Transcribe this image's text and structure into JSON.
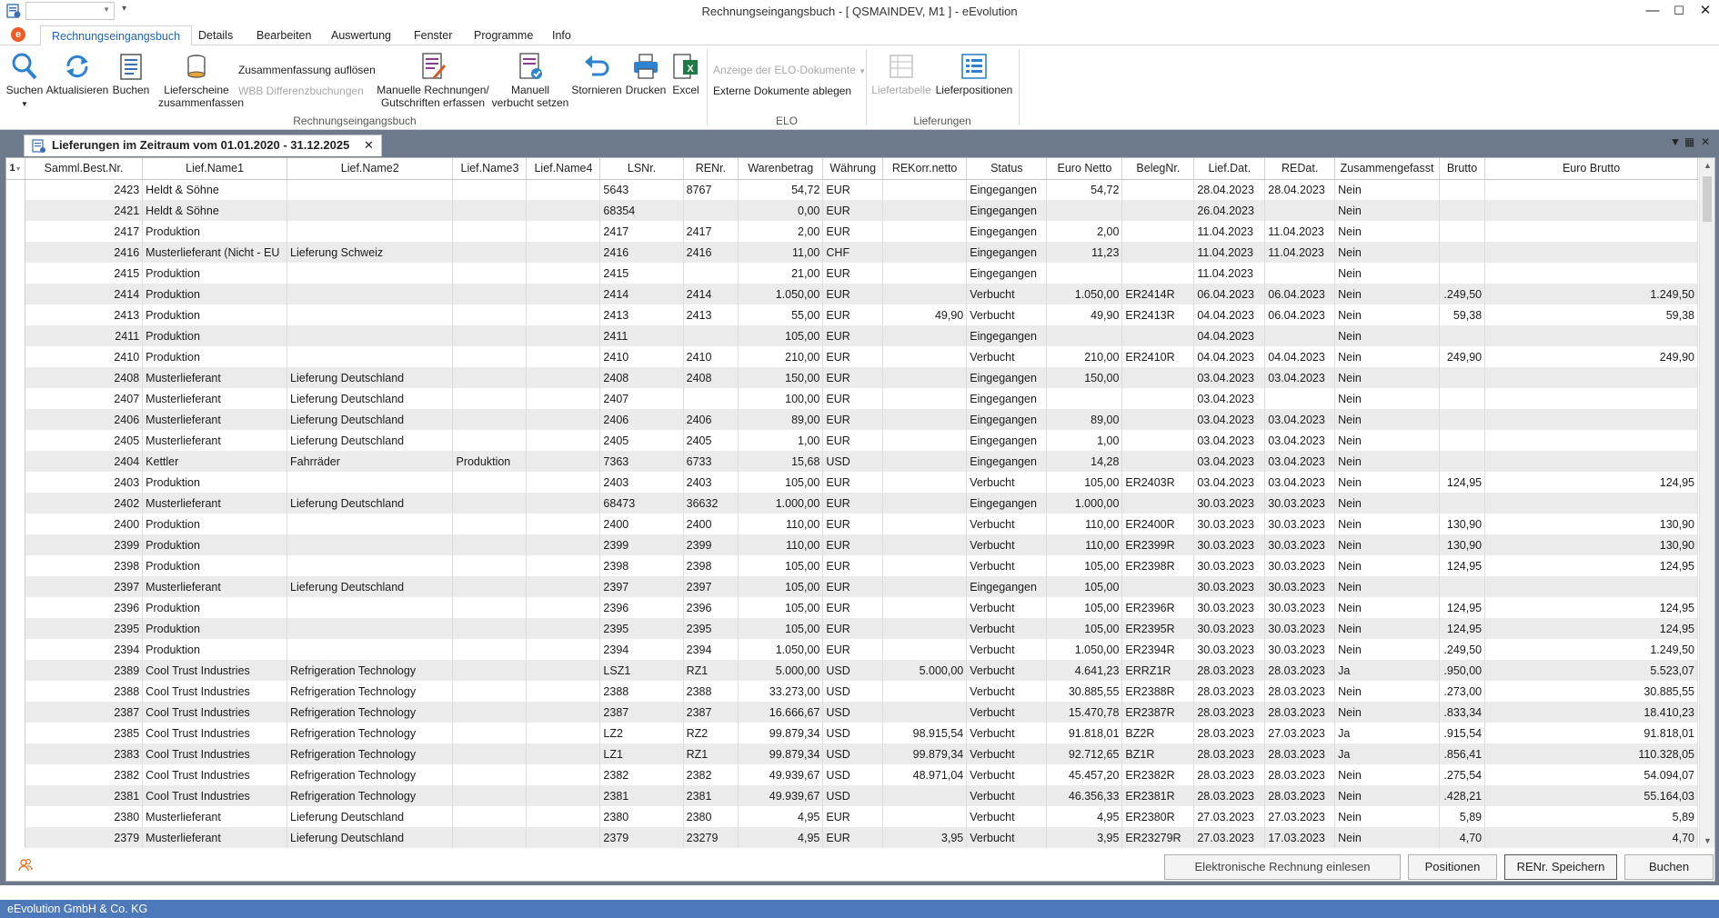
{
  "window": {
    "title": "Rechnungseingangsbuch - [ QSMAINDEV, M1 ]  -  eEvolution",
    "minimize": "—",
    "maximize": "☐",
    "close": "✕"
  },
  "ribbon_tabs": [
    "Rechnungseingangsbuch",
    "Details",
    "Bearbeiten",
    "Auswertung",
    "Fenster",
    "Programme",
    "Info"
  ],
  "ribbon": {
    "suchen": "Suchen",
    "aktualisieren": "Aktualisieren",
    "buchen": "Buchen",
    "lieferscheine_1": "Lieferscheine",
    "lieferscheine_2": "zusammenfassen",
    "zusammenfassung_aufloesen": "Zusammenfassung  auflösen",
    "wbb_differenz": "WBB Differenzbuchungen",
    "manuelle_rechnungen_1": "Manuelle Rechnungen/",
    "manuelle_rechnungen_2": "Gutschriften erfassen",
    "manuell_verbucht_1": "Manuell",
    "manuell_verbucht_2": "verbucht setzen",
    "stornieren": "Stornieren",
    "drucken": "Drucken",
    "excel": "Excel",
    "group_reb": "Rechnungseingangsbuch",
    "elo_anzeige": "Anzeige der ELO-Dokumente",
    "elo_ablegen": "Externe Dokumente ablegen",
    "group_elo": "ELO",
    "liefertabelle": "Liefertabelle",
    "lieferpositionen": "Lieferpositionen",
    "group_lieferungen": "Lieferungen"
  },
  "doc_tab": {
    "title": "Lieferungen im Zeitraum vom 01.01.2020 - 31.12.2025",
    "close": "✕"
  },
  "grid": {
    "sort_indicator": "1",
    "columns": [
      "Samml.Best.Nr.",
      "Lief.Name1",
      "Lief.Name2",
      "Lief.Name3",
      "Lief.Name4",
      "LSNr.",
      "RENr.",
      "Warenbetrag",
      "Währung",
      "REKorr.netto",
      "Status",
      "Euro Netto",
      "BelegNr.",
      "Lief.Dat.",
      "REDat.",
      "Zusammengefasst",
      "Brutto",
      "Euro Brutto"
    ],
    "rows": [
      [
        "2423",
        "Heldt & Söhne",
        "",
        "",
        "",
        "5643",
        "8767",
        "54,72",
        "EUR",
        "",
        "Eingegangen",
        "54,72",
        "",
        "28.04.2023",
        "28.04.2023",
        "Nein",
        "",
        ""
      ],
      [
        "2421",
        "Heldt & Söhne",
        "",
        "",
        "",
        "68354",
        "",
        "0,00",
        "EUR",
        "",
        "Eingegangen",
        "",
        "",
        "26.04.2023",
        "",
        "Nein",
        "",
        ""
      ],
      [
        "2417",
        "Produktion",
        "",
        "",
        "",
        "2417",
        "2417",
        "2,00",
        "EUR",
        "",
        "Eingegangen",
        "2,00",
        "",
        "11.04.2023",
        "11.04.2023",
        "Nein",
        "",
        ""
      ],
      [
        "2416",
        "Musterlieferant (Nicht - EU",
        "Lieferung Schweiz",
        "",
        "",
        "2416",
        "2416",
        "11,00",
        "CHF",
        "",
        "Eingegangen",
        "11,23",
        "",
        "11.04.2023",
        "11.04.2023",
        "Nein",
        "",
        ""
      ],
      [
        "2415",
        "Produktion",
        "",
        "",
        "",
        "2415",
        "",
        "21,00",
        "EUR",
        "",
        "Eingegangen",
        "",
        "",
        "11.04.2023",
        "",
        "Nein",
        "",
        ""
      ],
      [
        "2414",
        "Produktion",
        "",
        "",
        "",
        "2414",
        "2414",
        "1.050,00",
        "EUR",
        "",
        "Verbucht",
        "1.050,00",
        "ER2414R",
        "06.04.2023",
        "06.04.2023",
        "Nein",
        ".249,50",
        "1.249,50"
      ],
      [
        "2413",
        "Produktion",
        "",
        "",
        "",
        "2413",
        "2413",
        "55,00",
        "EUR",
        "49,90",
        "Verbucht",
        "49,90",
        "ER2413R",
        "04.04.2023",
        "06.04.2023",
        "Nein",
        "59,38",
        "59,38"
      ],
      [
        "2411",
        "Produktion",
        "",
        "",
        "",
        "2411",
        "",
        "105,00",
        "EUR",
        "",
        "Eingegangen",
        "",
        "",
        "04.04.2023",
        "",
        "Nein",
        "",
        ""
      ],
      [
        "2410",
        "Produktion",
        "",
        "",
        "",
        "2410",
        "2410",
        "210,00",
        "EUR",
        "",
        "Verbucht",
        "210,00",
        "ER2410R",
        "04.04.2023",
        "04.04.2023",
        "Nein",
        "249,90",
        "249,90"
      ],
      [
        "2408",
        "Musterlieferant",
        "Lieferung Deutschland",
        "",
        "",
        "2408",
        "2408",
        "150,00",
        "EUR",
        "",
        "Eingegangen",
        "150,00",
        "",
        "03.04.2023",
        "03.04.2023",
        "Nein",
        "",
        ""
      ],
      [
        "2407",
        "Musterlieferant",
        "Lieferung Deutschland",
        "",
        "",
        "2407",
        "",
        "100,00",
        "EUR",
        "",
        "Eingegangen",
        "",
        "",
        "03.04.2023",
        "",
        "Nein",
        "",
        ""
      ],
      [
        "2406",
        "Musterlieferant",
        "Lieferung Deutschland",
        "",
        "",
        "2406",
        "2406",
        "89,00",
        "EUR",
        "",
        "Eingegangen",
        "89,00",
        "",
        "03.04.2023",
        "03.04.2023",
        "Nein",
        "",
        ""
      ],
      [
        "2405",
        "Musterlieferant",
        "Lieferung Deutschland",
        "",
        "",
        "2405",
        "2405",
        "1,00",
        "EUR",
        "",
        "Eingegangen",
        "1,00",
        "",
        "03.04.2023",
        "03.04.2023",
        "Nein",
        "",
        ""
      ],
      [
        "2404",
        "Kettler",
        "Fahrräder",
        "Produktion",
        "",
        "7363",
        "6733",
        "15,68",
        "USD",
        "",
        "Eingegangen",
        "14,28",
        "",
        "03.04.2023",
        "03.04.2023",
        "Nein",
        "",
        ""
      ],
      [
        "2403",
        "Produktion",
        "",
        "",
        "",
        "2403",
        "2403",
        "105,00",
        "EUR",
        "",
        "Verbucht",
        "105,00",
        "ER2403R",
        "03.04.2023",
        "03.04.2023",
        "Nein",
        "124,95",
        "124,95"
      ],
      [
        "2402",
        "Musterlieferant",
        "Lieferung Deutschland",
        "",
        "",
        "68473",
        "36632",
        "1.000,00",
        "EUR",
        "",
        "Eingegangen",
        "1.000,00",
        "",
        "30.03.2023",
        "30.03.2023",
        "Nein",
        "",
        ""
      ],
      [
        "2400",
        "Produktion",
        "",
        "",
        "",
        "2400",
        "2400",
        "110,00",
        "EUR",
        "",
        "Verbucht",
        "110,00",
        "ER2400R",
        "30.03.2023",
        "30.03.2023",
        "Nein",
        "130,90",
        "130,90"
      ],
      [
        "2399",
        "Produktion",
        "",
        "",
        "",
        "2399",
        "2399",
        "110,00",
        "EUR",
        "",
        "Verbucht",
        "110,00",
        "ER2399R",
        "30.03.2023",
        "30.03.2023",
        "Nein",
        "130,90",
        "130,90"
      ],
      [
        "2398",
        "Produktion",
        "",
        "",
        "",
        "2398",
        "2398",
        "105,00",
        "EUR",
        "",
        "Verbucht",
        "105,00",
        "ER2398R",
        "30.03.2023",
        "30.03.2023",
        "Nein",
        "124,95",
        "124,95"
      ],
      [
        "2397",
        "Musterlieferant",
        "Lieferung Deutschland",
        "",
        "",
        "2397",
        "2397",
        "105,00",
        "EUR",
        "",
        "Eingegangen",
        "105,00",
        "",
        "30.03.2023",
        "30.03.2023",
        "Nein",
        "",
        ""
      ],
      [
        "2396",
        "Produktion",
        "",
        "",
        "",
        "2396",
        "2396",
        "105,00",
        "EUR",
        "",
        "Verbucht",
        "105,00",
        "ER2396R",
        "30.03.2023",
        "30.03.2023",
        "Nein",
        "124,95",
        "124,95"
      ],
      [
        "2395",
        "Produktion",
        "",
        "",
        "",
        "2395",
        "2395",
        "105,00",
        "EUR",
        "",
        "Verbucht",
        "105,00",
        "ER2395R",
        "30.03.2023",
        "30.03.2023",
        "Nein",
        "124,95",
        "124,95"
      ],
      [
        "2394",
        "Produktion",
        "",
        "",
        "",
        "2394",
        "2394",
        "1.050,00",
        "EUR",
        "",
        "Verbucht",
        "1.050,00",
        "ER2394R",
        "30.03.2023",
        "30.03.2023",
        "Nein",
        ".249,50",
        "1.249,50"
      ],
      [
        "2389",
        "Cool Trust Industries",
        "Refrigeration Technology",
        "",
        "",
        "LSZ1",
        "RZ1",
        "5.000,00",
        "USD",
        "5.000,00",
        "Verbucht",
        "4.641,23",
        "ERRZ1R",
        "28.03.2023",
        "28.03.2023",
        "Ja",
        ".950,00",
        "5.523,07"
      ],
      [
        "2388",
        "Cool Trust Industries",
        "Refrigeration Technology",
        "",
        "",
        "2388",
        "2388",
        "33.273,00",
        "USD",
        "",
        "Verbucht",
        "30.885,55",
        "ER2388R",
        "28.03.2023",
        "28.03.2023",
        "Nein",
        ".273,00",
        "30.885,55"
      ],
      [
        "2387",
        "Cool Trust Industries",
        "Refrigeration Technology",
        "",
        "",
        "2387",
        "2387",
        "16.666,67",
        "USD",
        "",
        "Verbucht",
        "15.470,78",
        "ER2387R",
        "28.03.2023",
        "28.03.2023",
        "Nein",
        ".833,34",
        "18.410,23"
      ],
      [
        "2385",
        "Cool Trust Industries",
        "Refrigeration Technology",
        "",
        "",
        "LZ2",
        "RZ2",
        "99.879,34",
        "USD",
        "98.915,54",
        "Verbucht",
        "91.818,01",
        "BZ2R",
        "28.03.2023",
        "27.03.2023",
        "Ja",
        ".915,54",
        "91.818,01"
      ],
      [
        "2383",
        "Cool Trust Industries",
        "Refrigeration Technology",
        "",
        "",
        "LZ1",
        "RZ1",
        "99.879,34",
        "USD",
        "99.879,34",
        "Verbucht",
        "92.712,65",
        "BZ1R",
        "28.03.2023",
        "28.03.2023",
        "Ja",
        ".856,41",
        "110.328,05"
      ],
      [
        "2382",
        "Cool Trust Industries",
        "Refrigeration Technology",
        "",
        "",
        "2382",
        "2382",
        "49.939,67",
        "USD",
        "48.971,04",
        "Verbucht",
        "45.457,20",
        "ER2382R",
        "28.03.2023",
        "28.03.2023",
        "Nein",
        ".275,54",
        "54.094,07"
      ],
      [
        "2381",
        "Cool Trust Industries",
        "Refrigeration Technology",
        "",
        "",
        "2381",
        "2381",
        "49.939,67",
        "USD",
        "",
        "Verbucht",
        "46.356,33",
        "ER2381R",
        "28.03.2023",
        "28.03.2023",
        "Nein",
        ".428,21",
        "55.164,03"
      ],
      [
        "2380",
        "Musterlieferant",
        "Lieferung Deutschland",
        "",
        "",
        "2380",
        "2380",
        "4,95",
        "EUR",
        "",
        "Verbucht",
        "4,95",
        "ER2380R",
        "27.03.2023",
        "27.03.2023",
        "Nein",
        "5,89",
        "5,89"
      ],
      [
        "2379",
        "Musterlieferant",
        "Lieferung Deutschland",
        "",
        "",
        "2379",
        "23279",
        "4,95",
        "EUR",
        "3,95",
        "Verbucht",
        "3,95",
        "ER23279R",
        "27.03.2023",
        "17.03.2023",
        "Nein",
        "4,70",
        "4,70"
      ]
    ]
  },
  "buttons": {
    "e_rechnung": "Elektronische Rechnung einlesen",
    "positionen": "Positionen",
    "renr_speichern": "RENr. Speichern",
    "buchen": "Buchen"
  },
  "statusbar": {
    "company": "eEvolution GmbH & Co. KG"
  },
  "colors": {
    "accent": "#2264b5",
    "statusbar": "#4d79ba",
    "row_alt": "#ebebeb",
    "doc_bg": "#6d7a8c"
  }
}
